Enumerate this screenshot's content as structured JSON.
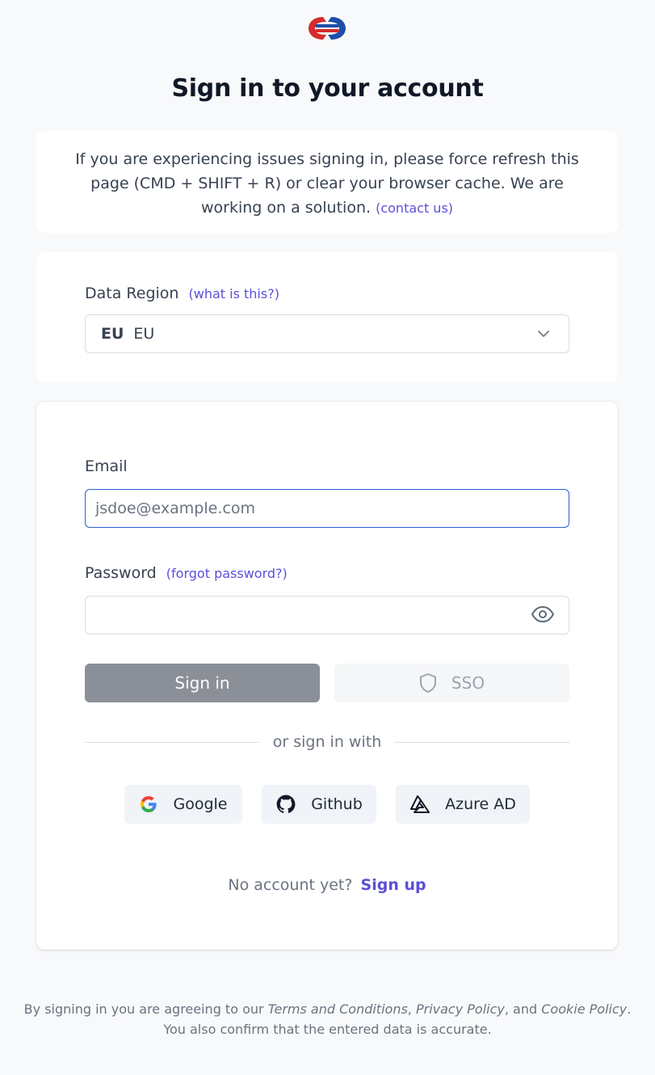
{
  "page": {
    "title": "Sign in to your account"
  },
  "notice": {
    "text": "If you are experiencing issues signing in, please force refresh this page (CMD + SHIFT + R) or clear your browser cache. We are working on a solution.",
    "contact_link": "(contact us)"
  },
  "region": {
    "label": "Data Region",
    "help_link": "(what is this?)",
    "selected_code": "EU",
    "selected_name": "EU"
  },
  "login": {
    "email_label": "Email",
    "email_placeholder": "jsdoe@example.com",
    "email_value": "",
    "password_label": "Password",
    "forgot_link": "(forgot password?)",
    "password_value": "",
    "signin_button": "Sign in",
    "sso_button": "SSO",
    "divider_text": "or sign in with",
    "social": [
      {
        "label": "Google",
        "icon": "google-icon"
      },
      {
        "label": "Github",
        "icon": "github-icon"
      },
      {
        "label": "Azure AD",
        "icon": "azure-icon"
      }
    ],
    "signup_prompt": "No account yet?",
    "signup_link": "Sign up"
  },
  "footer": {
    "prefix": "By signing in you are agreeing to our",
    "terms": "Terms and Conditions",
    "privacy": "Privacy Policy",
    "and": "and",
    "cookie": "Cookie Policy",
    "suffix": "You also confirm that the entered data is accurate."
  },
  "colors": {
    "accent": "#5b4fd8",
    "focus_border": "#2f5fd0",
    "signin_button_bg": "#8a8f98",
    "background": "#f8f9fb"
  }
}
